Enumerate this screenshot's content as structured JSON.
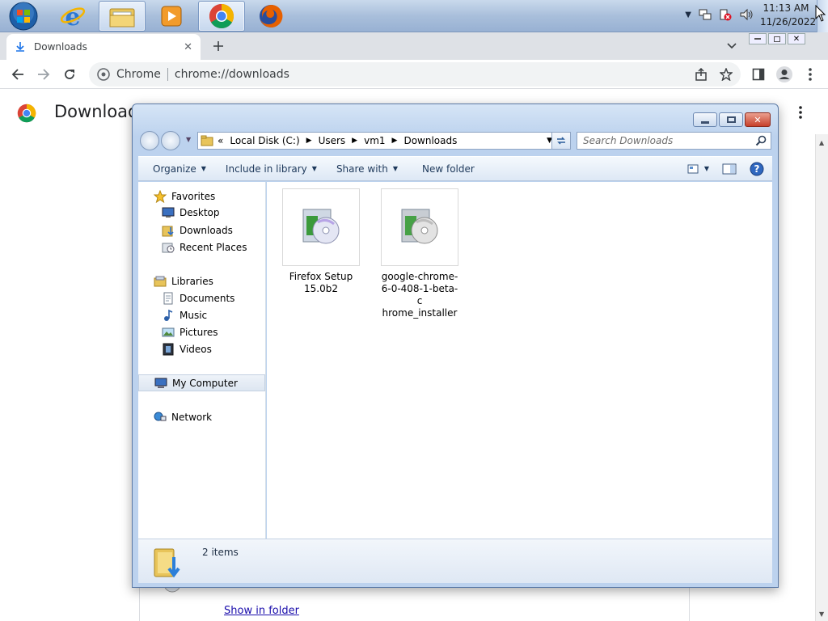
{
  "taskbar": {
    "clock_time": "11:13 AM",
    "clock_date": "11/26/2022",
    "apps": [
      "start-orb",
      "internet-explorer",
      "windows-explorer",
      "media-player",
      "chrome",
      "firefox"
    ]
  },
  "chrome": {
    "tab_title": "Downloads",
    "omnibox_site": "Chrome",
    "omnibox_url": "chrome://downloads",
    "page_title": "Download",
    "show_in_folder": "Show in folder",
    "accent": "#1a73e8"
  },
  "explorer": {
    "breadcrumb": [
      "Local Disk (C:)",
      "Users",
      "vm1",
      "Downloads"
    ],
    "breadcrumb_prefix": "«",
    "search_placeholder": "Search Downloads",
    "commands": {
      "organize": "Organize",
      "include_in_library": "Include in library",
      "share_with": "Share with",
      "new_folder": "New folder"
    },
    "nav": {
      "favorites": "Favorites",
      "desktop": "Desktop",
      "downloads": "Downloads",
      "recent_places": "Recent Places",
      "libraries": "Libraries",
      "documents": "Documents",
      "music": "Music",
      "pictures": "Pictures",
      "videos": "Videos",
      "my_computer": "My Computer",
      "network": "Network"
    },
    "files": [
      {
        "name_line1": "Firefox Setup",
        "name_line2": "15.0b2",
        "name_line3": ""
      },
      {
        "name_line1": "google-chrome-",
        "name_line2": "6-0-408-1-beta-c",
        "name_line3": "hrome_installer"
      }
    ],
    "status": "2 items"
  }
}
